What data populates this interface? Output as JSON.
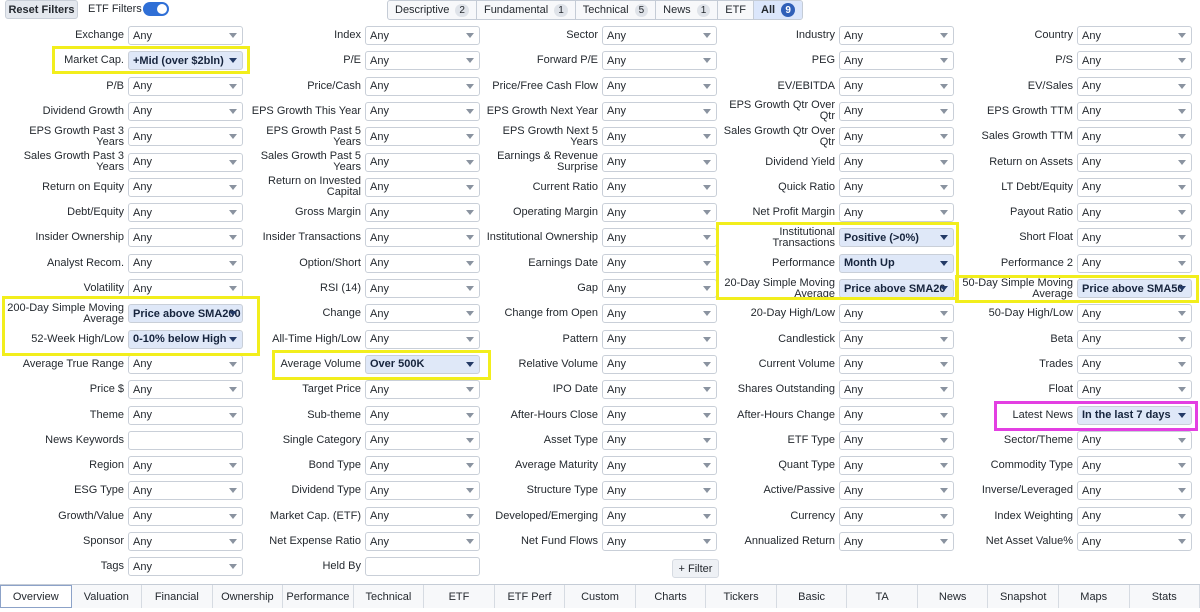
{
  "top": {
    "reset_label": "Reset Filters",
    "etf_filters_label": "ETF Filters",
    "tabs": [
      {
        "label": "Descriptive",
        "count": "2"
      },
      {
        "label": "Fundamental",
        "count": "1"
      },
      {
        "label": "Technical",
        "count": "5"
      },
      {
        "label": "News",
        "count": "1"
      },
      {
        "label": "ETF",
        "count": ""
      },
      {
        "label": "All",
        "count": "9"
      }
    ]
  },
  "filters": [
    [
      {
        "label": "Exchange",
        "value": "Any"
      },
      {
        "label": "Index",
        "value": "Any"
      },
      {
        "label": "Sector",
        "value": "Any"
      },
      {
        "label": "Industry",
        "value": "Any"
      },
      {
        "label": "Country",
        "value": "Any"
      }
    ],
    [
      {
        "label": "Market Cap.",
        "value": "+Mid (over $2bln)",
        "active": true
      },
      {
        "label": "P/E",
        "value": "Any"
      },
      {
        "label": "Forward P/E",
        "value": "Any"
      },
      {
        "label": "PEG",
        "value": "Any"
      },
      {
        "label": "P/S",
        "value": "Any"
      }
    ],
    [
      {
        "label": "P/B",
        "value": "Any"
      },
      {
        "label": "Price/Cash",
        "value": "Any"
      },
      {
        "label": "Price/Free Cash Flow",
        "value": "Any"
      },
      {
        "label": "EV/EBITDA",
        "value": "Any"
      },
      {
        "label": "EV/Sales",
        "value": "Any"
      }
    ],
    [
      {
        "label": "Dividend Growth",
        "value": "Any"
      },
      {
        "label": "EPS Growth This Year",
        "value": "Any"
      },
      {
        "label": "EPS Growth Next Year",
        "value": "Any"
      },
      {
        "label": "EPS Growth Qtr Over Qtr",
        "value": "Any"
      },
      {
        "label": "EPS Growth TTM",
        "value": "Any"
      }
    ],
    [
      {
        "label": "EPS Growth Past 3 Years",
        "value": "Any"
      },
      {
        "label": "EPS Growth Past 5 Years",
        "value": "Any"
      },
      {
        "label": "EPS Growth Next 5 Years",
        "value": "Any"
      },
      {
        "label": "Sales Growth Qtr Over Qtr",
        "value": "Any"
      },
      {
        "label": "Sales Growth TTM",
        "value": "Any"
      }
    ],
    [
      {
        "label": "Sales Growth Past 3 Years",
        "value": "Any"
      },
      {
        "label": "Sales Growth Past 5 Years",
        "value": "Any"
      },
      {
        "label": "Earnings & Revenue Surprise",
        "value": "Any"
      },
      {
        "label": "Dividend Yield",
        "value": "Any"
      },
      {
        "label": "Return on Assets",
        "value": "Any"
      }
    ],
    [
      {
        "label": "Return on Equity",
        "value": "Any"
      },
      {
        "label": "Return on Invested Capital",
        "value": "Any"
      },
      {
        "label": "Current Ratio",
        "value": "Any"
      },
      {
        "label": "Quick Ratio",
        "value": "Any"
      },
      {
        "label": "LT Debt/Equity",
        "value": "Any"
      }
    ],
    [
      {
        "label": "Debt/Equity",
        "value": "Any"
      },
      {
        "label": "Gross Margin",
        "value": "Any"
      },
      {
        "label": "Operating Margin",
        "value": "Any"
      },
      {
        "label": "Net Profit Margin",
        "value": "Any"
      },
      {
        "label": "Payout Ratio",
        "value": "Any"
      }
    ],
    [
      {
        "label": "Insider Ownership",
        "value": "Any"
      },
      {
        "label": "Insider Transactions",
        "value": "Any"
      },
      {
        "label": "Institutional Ownership",
        "value": "Any"
      },
      {
        "label": "Institutional Transactions",
        "value": "Positive (>0%)",
        "active": true
      },
      {
        "label": "Short Float",
        "value": "Any"
      }
    ],
    [
      {
        "label": "Analyst Recom.",
        "value": "Any"
      },
      {
        "label": "Option/Short",
        "value": "Any"
      },
      {
        "label": "Earnings Date",
        "value": "Any"
      },
      {
        "label": "Performance",
        "value": "Month Up",
        "active": true
      },
      {
        "label": "Performance 2",
        "value": "Any"
      }
    ],
    [
      {
        "label": "Volatility",
        "value": "Any"
      },
      {
        "label": "RSI (14)",
        "value": "Any"
      },
      {
        "label": "Gap",
        "value": "Any"
      },
      {
        "label": "20-Day Simple Moving Average",
        "value": "Price above SMA20",
        "active": true
      },
      {
        "label": "50-Day Simple Moving Average",
        "value": "Price above SMA50",
        "active": true
      }
    ],
    [
      {
        "label": "200-Day Simple Moving Average",
        "value": "Price above SMA200",
        "active": true
      },
      {
        "label": "Change",
        "value": "Any"
      },
      {
        "label": "Change from Open",
        "value": "Any"
      },
      {
        "label": "20-Day High/Low",
        "value": "Any"
      },
      {
        "label": "50-Day High/Low",
        "value": "Any"
      }
    ],
    [
      {
        "label": "52-Week High/Low",
        "value": "0-10% below High",
        "active": true
      },
      {
        "label": "All-Time High/Low",
        "value": "Any"
      },
      {
        "label": "Pattern",
        "value": "Any"
      },
      {
        "label": "Candlestick",
        "value": "Any"
      },
      {
        "label": "Beta",
        "value": "Any"
      }
    ],
    [
      {
        "label": "Average True Range",
        "value": "Any"
      },
      {
        "label": "Average Volume",
        "value": "Over 500K",
        "active": true
      },
      {
        "label": "Relative Volume",
        "value": "Any"
      },
      {
        "label": "Current Volume",
        "value": "Any"
      },
      {
        "label": "Trades",
        "value": "Any"
      }
    ],
    [
      {
        "label": "Price $",
        "value": "Any"
      },
      {
        "label": "Target Price",
        "value": "Any"
      },
      {
        "label": "IPO Date",
        "value": "Any"
      },
      {
        "label": "Shares Outstanding",
        "value": "Any"
      },
      {
        "label": "Float",
        "value": "Any"
      }
    ],
    [
      {
        "label": "Theme",
        "value": "Any"
      },
      {
        "label": "Sub-theme",
        "value": "Any"
      },
      {
        "label": "After-Hours Close",
        "value": "Any"
      },
      {
        "label": "After-Hours Change",
        "value": "Any"
      },
      {
        "label": "Latest News",
        "value": "In the last 7 days",
        "active": true
      }
    ],
    [
      {
        "label": "News Keywords",
        "value": "",
        "input": true
      },
      {
        "label": "Single Category",
        "value": "Any"
      },
      {
        "label": "Asset Type",
        "value": "Any"
      },
      {
        "label": "ETF Type",
        "value": "Any"
      },
      {
        "label": "Sector/Theme",
        "value": "Any"
      }
    ],
    [
      {
        "label": "Region",
        "value": "Any"
      },
      {
        "label": "Bond Type",
        "value": "Any"
      },
      {
        "label": "Average Maturity",
        "value": "Any"
      },
      {
        "label": "Quant Type",
        "value": "Any"
      },
      {
        "label": "Commodity Type",
        "value": "Any"
      }
    ],
    [
      {
        "label": "ESG Type",
        "value": "Any"
      },
      {
        "label": "Dividend Type",
        "value": "Any"
      },
      {
        "label": "Structure Type",
        "value": "Any"
      },
      {
        "label": "Active/Passive",
        "value": "Any"
      },
      {
        "label": "Inverse/Leveraged",
        "value": "Any"
      }
    ],
    [
      {
        "label": "Growth/Value",
        "value": "Any"
      },
      {
        "label": "Market Cap. (ETF)",
        "value": "Any"
      },
      {
        "label": "Developed/Emerging",
        "value": "Any"
      },
      {
        "label": "Currency",
        "value": "Any"
      },
      {
        "label": "Index Weighting",
        "value": "Any"
      }
    ],
    [
      {
        "label": "Sponsor",
        "value": "Any"
      },
      {
        "label": "Net Expense Ratio",
        "value": "Any"
      },
      {
        "label": "Net Fund Flows",
        "value": "Any"
      },
      {
        "label": "Annualized Return",
        "value": "Any"
      },
      {
        "label": "Net Asset Value%",
        "value": "Any"
      }
    ],
    [
      {
        "label": "Tags",
        "value": "Any"
      },
      {
        "label": "Held By",
        "value": "",
        "input": true
      }
    ]
  ],
  "filter_button": "+ Filter",
  "bottom_tabs": [
    "Overview",
    "Valuation",
    "Financial",
    "Ownership",
    "Performance",
    "Technical",
    "ETF",
    "ETF Perf",
    "Custom",
    "Charts",
    "Tickers",
    "Basic",
    "TA",
    "News",
    "Snapshot",
    "Maps",
    "Stats"
  ],
  "highlight_colors": {
    "yellow": "#f2ee1c",
    "magenta": "#e33fe2",
    "accent": "#2f6fd6"
  }
}
